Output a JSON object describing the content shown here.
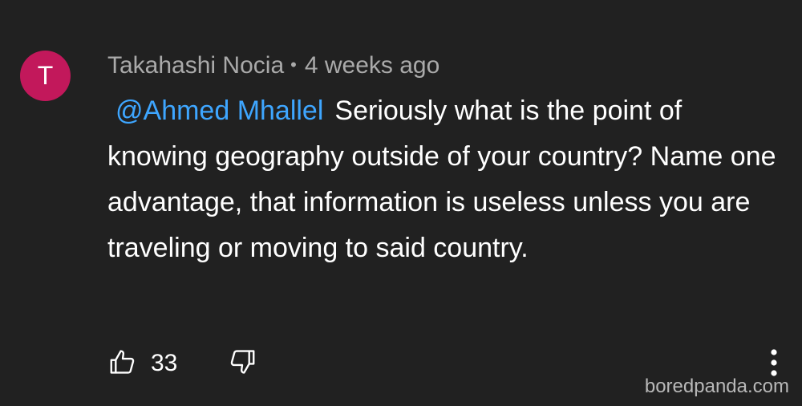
{
  "comment": {
    "avatar_initial": "T",
    "avatar_color": "#c2185b",
    "author": "Takahashi Nocia",
    "separator": "•",
    "timestamp": "4 weeks ago",
    "mention": "@Ahmed Mhallel",
    "text": "Seriously what is the point of knowing geography outside of your country? Name one advantage, that information is useless unless you are traveling or moving to said country.",
    "like_count": "33",
    "like_icon": "thumbs-up-icon",
    "dislike_icon": "thumbs-down-icon",
    "menu_icon": "more-vert-icon"
  },
  "watermark": "boredpanda.com",
  "colors": {
    "background": "#212121",
    "mention": "#3ea6ff",
    "meta_text": "#aaaaaa"
  }
}
